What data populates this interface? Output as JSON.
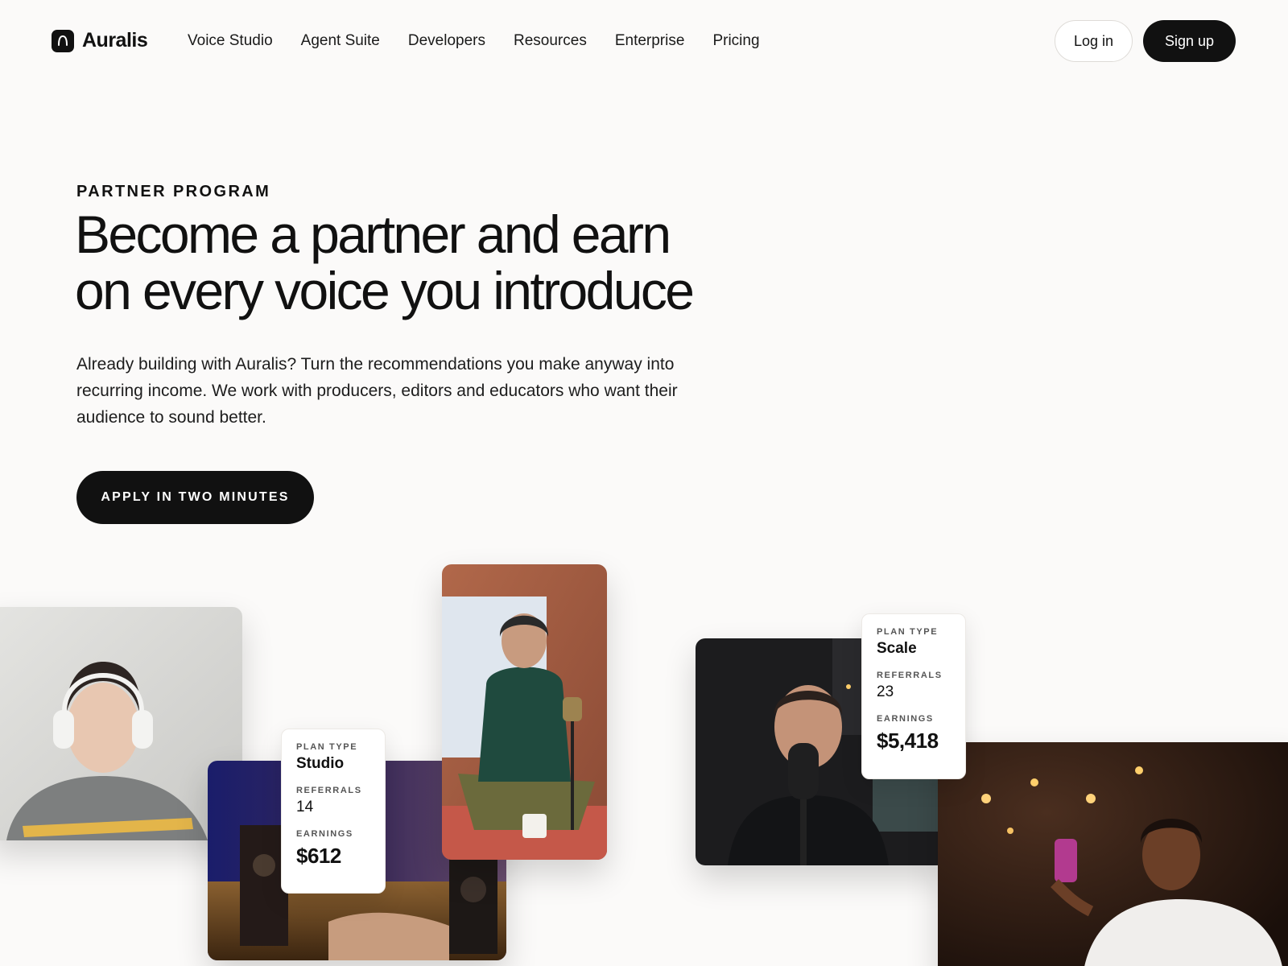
{
  "nav": {
    "brand": "Auralis",
    "links": [
      "Voice Studio",
      "Agent Suite",
      "Developers",
      "Resources",
      "Enterprise",
      "Pricing"
    ],
    "login": "Log in",
    "signup": "Sign up"
  },
  "hero": {
    "eyebrow": "PARTNER PROGRAM",
    "headline_line1": "Become a partner and earn",
    "headline_line2": "on every voice you introduce",
    "lead": "Already building with Auralis? Turn the recommendations you make anyway into recurring income. We work with producers, editors and educators who want their audience to sound better.",
    "cta": "APPLY IN TWO MINUTES"
  },
  "cards": [
    {
      "plan_label": "PLAN TYPE",
      "plan": "Studio",
      "referrals_label": "REFERRALS",
      "referrals": "14",
      "earnings_label": "EARNINGS",
      "earnings": "$612"
    },
    {
      "plan_label": "PLAN TYPE",
      "plan": "Scale",
      "referrals_label": "REFERRALS",
      "referrals": "23",
      "earnings_label": "EARNINGS",
      "earnings": "$5,418"
    }
  ],
  "icons": {
    "logo": "auralis-logo-icon"
  }
}
